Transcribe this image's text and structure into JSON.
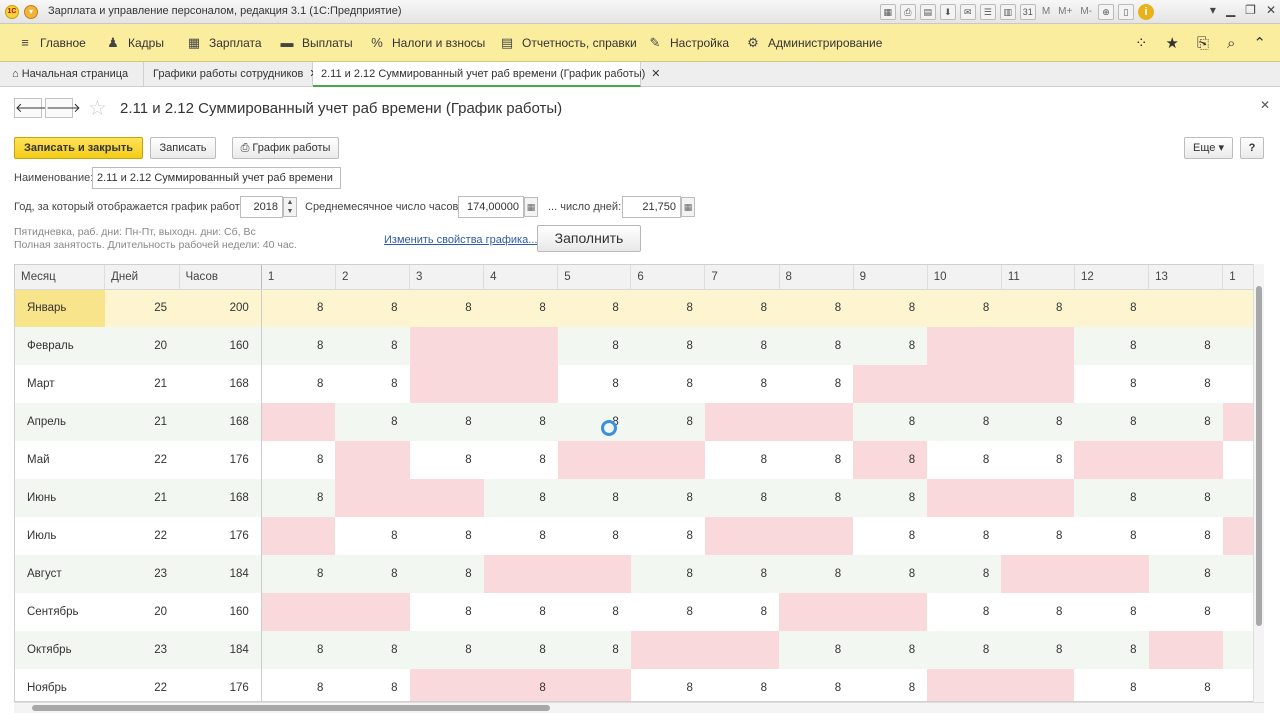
{
  "window": {
    "title": "Зарплата и управление персоналом, редакция 3.1  (1С:Предприятие)",
    "toolbar_labels": [
      "M",
      "M+",
      "M-"
    ]
  },
  "menu": {
    "items": [
      {
        "label": "Главное",
        "icon": "hamburger-icon"
      },
      {
        "label": "Кадры",
        "icon": "people-icon"
      },
      {
        "label": "Зарплата",
        "icon": "calculator-icon"
      },
      {
        "label": "Выплаты",
        "icon": "wallet-icon"
      },
      {
        "label": "Налоги и взносы",
        "icon": "percent-icon"
      },
      {
        "label": "Отчетность, справки",
        "icon": "report-icon"
      },
      {
        "label": "Настройка",
        "icon": "wrench-icon"
      },
      {
        "label": "Администрирование",
        "icon": "gear-icon"
      }
    ]
  },
  "tabs": [
    {
      "label": "Начальная страница",
      "icon": "home-icon",
      "closable": false
    },
    {
      "label": "Графики работы сотрудников",
      "closable": true
    },
    {
      "label": "2.11 и 2.12 Суммированный учет раб времени (График работы)",
      "closable": true,
      "active": true
    }
  ],
  "form": {
    "title": "2.11 и 2.12 Суммированный учет раб времени (График работы)",
    "btn_save_close": "Записать и закрыть",
    "btn_save": "Записать",
    "btn_schedule": "График работы",
    "btn_more": "Еще",
    "btn_help": "?",
    "name_label": "Наименование:",
    "name_value": "2.11 и 2.12 Суммированный учет раб времени",
    "year_label": "Год, за который отображается график работы:",
    "year_value": "2018",
    "avg_hours_label": "Среднемесячное число часов:",
    "avg_hours_value": "174,00000",
    "days_label": "... число дней:",
    "days_value": "21,750",
    "note_line1": "Пятидневка, раб. дни: Пн-Пт, выходн. дни: Сб, Вс",
    "note_line2": "Полная занятость. Длительность рабочей недели: 40 час.",
    "link_change": "Изменить свойства графика...",
    "btn_fill": "Заполнить"
  },
  "grid": {
    "headers": [
      "Месяц",
      "Дней",
      "Часов",
      "1",
      "2",
      "3",
      "4",
      "5",
      "6",
      "7",
      "8",
      "9",
      "10",
      "11",
      "12",
      "13",
      "1"
    ],
    "rows": [
      {
        "month": "Январь",
        "days": "25",
        "hours": "200",
        "cells": [
          "8",
          "8",
          "8",
          "8",
          "8",
          "8",
          "8",
          "8",
          "8",
          "8",
          "8",
          "8",
          ""
        ],
        "off": [],
        "selected": true
      },
      {
        "month": "Февраль",
        "days": "20",
        "hours": "160",
        "cells": [
          "8",
          "8",
          "",
          "",
          "8",
          "8",
          "8",
          "8",
          "8",
          "",
          "",
          "8",
          "8"
        ],
        "off": [
          2,
          3,
          9,
          10
        ]
      },
      {
        "month": "Март",
        "days": "21",
        "hours": "168",
        "cells": [
          "8",
          "8",
          "",
          "",
          "8",
          "8",
          "8",
          "8",
          "",
          "",
          "",
          "8",
          "8"
        ],
        "off": [
          2,
          3,
          8,
          9,
          10
        ]
      },
      {
        "month": "Апрель",
        "days": "21",
        "hours": "168",
        "cells": [
          "",
          "8",
          "8",
          "8",
          "8",
          "8",
          "",
          "",
          "8",
          "8",
          "8",
          "8",
          "8"
        ],
        "off": [
          0,
          6,
          7,
          13
        ]
      },
      {
        "month": "Май",
        "days": "22",
        "hours": "176",
        "cells": [
          "8",
          "",
          "8",
          "8",
          "",
          "",
          "8",
          "8",
          "8",
          "8",
          "8",
          "",
          ""
        ],
        "off": [
          1,
          4,
          5,
          8,
          11,
          12
        ]
      },
      {
        "month": "Июнь",
        "days": "21",
        "hours": "168",
        "cells": [
          "8",
          "",
          "",
          "8",
          "8",
          "8",
          "8",
          "8",
          "8",
          "",
          "",
          "8",
          "8"
        ],
        "off": [
          1,
          2,
          9,
          10
        ]
      },
      {
        "month": "Июль",
        "days": "22",
        "hours": "176",
        "cells": [
          "",
          "8",
          "8",
          "8",
          "8",
          "8",
          "",
          "",
          "8",
          "8",
          "8",
          "8",
          "8"
        ],
        "off": [
          0,
          6,
          7,
          13
        ]
      },
      {
        "month": "Август",
        "days": "23",
        "hours": "184",
        "cells": [
          "8",
          "8",
          "8",
          "",
          "",
          "8",
          "8",
          "8",
          "8",
          "8",
          "",
          "",
          "8"
        ],
        "off": [
          3,
          4,
          10,
          11
        ]
      },
      {
        "month": "Сентябрь",
        "days": "20",
        "hours": "160",
        "cells": [
          "",
          "",
          "8",
          "8",
          "8",
          "8",
          "8",
          "",
          "",
          "8",
          "8",
          "8",
          "8"
        ],
        "off": [
          0,
          1,
          7,
          8
        ]
      },
      {
        "month": "Октябрь",
        "days": "23",
        "hours": "184",
        "cells": [
          "8",
          "8",
          "8",
          "8",
          "8",
          "",
          "",
          "8",
          "8",
          "8",
          "8",
          "8",
          ""
        ],
        "off": [
          5,
          6,
          12
        ]
      },
      {
        "month": "Ноябрь",
        "days": "22",
        "hours": "176",
        "cells": [
          "8",
          "8",
          "",
          "8",
          "",
          "8",
          "8",
          "8",
          "8",
          "",
          "",
          "8",
          "8"
        ],
        "off": [
          2,
          3,
          4,
          9,
          10
        ]
      }
    ]
  },
  "colors": {
    "menu_bg": "#fbed9e",
    "primary_btn": "#f2cc16",
    "weekend_cell": "#f9d9dc",
    "selected_row": "#fcf5d0",
    "even_row": "#f3f7f1"
  }
}
